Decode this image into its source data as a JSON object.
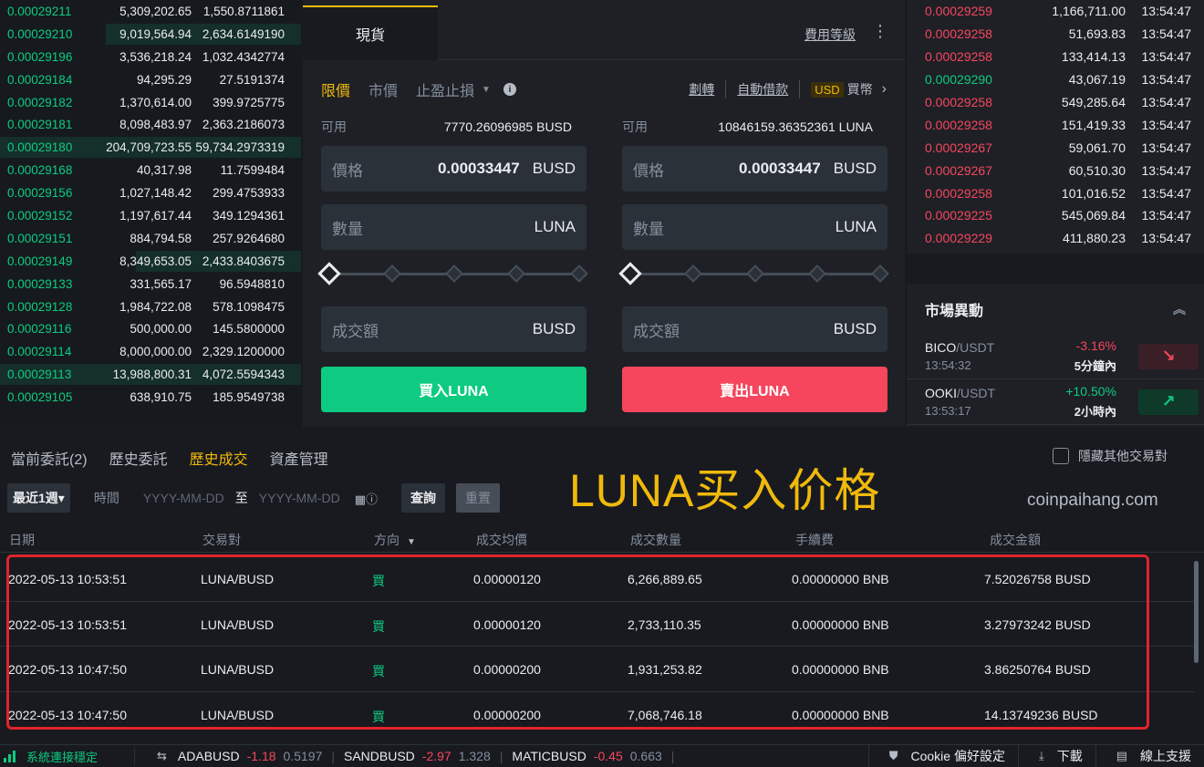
{
  "order_book_bids": [
    {
      "price": "0.00029211",
      "amount": "5,309,202.65",
      "total": "1,550.8711861",
      "depth": 0.0
    },
    {
      "price": "0.00029210",
      "amount": "9,019,564.94",
      "total": "2,634.6149190",
      "depth": 0.65
    },
    {
      "price": "0.00029196",
      "amount": "3,536,218.24",
      "total": "1,032.4342774",
      "depth": 0.0
    },
    {
      "price": "0.00029184",
      "amount": "94,295.29",
      "total": "27.5191374",
      "depth": 0.0
    },
    {
      "price": "0.00029182",
      "amount": "1,370,614.00",
      "total": "399.9725775",
      "depth": 0.0
    },
    {
      "price": "0.00029181",
      "amount": "8,098,483.97",
      "total": "2,363.2186073",
      "depth": 0.0
    },
    {
      "price": "0.00029180",
      "amount": "204,709,723.55",
      "total": "59,734.2973319",
      "depth": 1.0
    },
    {
      "price": "0.00029168",
      "amount": "40,317.98",
      "total": "11.7599484",
      "depth": 0.0
    },
    {
      "price": "0.00029156",
      "amount": "1,027,148.42",
      "total": "299.4753933",
      "depth": 0.0
    },
    {
      "price": "0.00029152",
      "amount": "1,197,617.44",
      "total": "349.1294361",
      "depth": 0.0
    },
    {
      "price": "0.00029151",
      "amount": "884,794.58",
      "total": "257.9264680",
      "depth": 0.0
    },
    {
      "price": "0.00029149",
      "amount": "8,349,653.05",
      "total": "2,433.8403675",
      "depth": 0.55
    },
    {
      "price": "0.00029133",
      "amount": "331,565.17",
      "total": "96.5948810",
      "depth": 0.0
    },
    {
      "price": "0.00029128",
      "amount": "1,984,722.08",
      "total": "578.1098475",
      "depth": 0.0
    },
    {
      "price": "0.00029116",
      "amount": "500,000.00",
      "total": "145.5800000",
      "depth": 0.0
    },
    {
      "price": "0.00029114",
      "amount": "8,000,000.00",
      "total": "2,329.1200000",
      "depth": 0.0
    },
    {
      "price": "0.00029113",
      "amount": "13,988,800.31",
      "total": "4,072.5594343",
      "depth": 1.0
    },
    {
      "price": "0.00029105",
      "amount": "638,910.75",
      "total": "185.9549738",
      "depth": 0.0
    }
  ],
  "center": {
    "tab_spot": "現貨",
    "fee_level": "費用等級",
    "kebab": "⋮",
    "order_types": {
      "limit": "限價",
      "market": "市價",
      "stop": "止盈止損"
    },
    "transfer": "劃轉",
    "auto_borrow": "自動借款",
    "usd_badge": "USD",
    "buy_coin": "買幣",
    "buy": {
      "avail_label": "可用",
      "avail_value": "7770.26096985 BUSD",
      "price_label": "價格",
      "price_value": "0.00033447",
      "price_unit": "BUSD",
      "qty_label": "數量",
      "qty_unit": "LUNA",
      "total_label": "成交額",
      "total_unit": "BUSD",
      "button": "買入LUNA"
    },
    "sell": {
      "avail_label": "可用",
      "avail_value": "10846159.36352361 LUNA",
      "price_label": "價格",
      "price_value": "0.00033447",
      "price_unit": "BUSD",
      "qty_label": "數量",
      "qty_unit": "LUNA",
      "total_label": "成交額",
      "total_unit": "BUSD",
      "button": "賣出LUNA"
    }
  },
  "recent_trades": [
    {
      "price": "0.00029259",
      "amount": "1,166,711.00",
      "time": "13:54:47",
      "side": "red"
    },
    {
      "price": "0.00029258",
      "amount": "51,693.83",
      "time": "13:54:47",
      "side": "red"
    },
    {
      "price": "0.00029258",
      "amount": "133,414.13",
      "time": "13:54:47",
      "side": "red"
    },
    {
      "price": "0.00029290",
      "amount": "43,067.19",
      "time": "13:54:47",
      "side": "green"
    },
    {
      "price": "0.00029258",
      "amount": "549,285.64",
      "time": "13:54:47",
      "side": "red"
    },
    {
      "price": "0.00029258",
      "amount": "151,419.33",
      "time": "13:54:47",
      "side": "red"
    },
    {
      "price": "0.00029267",
      "amount": "59,061.70",
      "time": "13:54:47",
      "side": "red"
    },
    {
      "price": "0.00029267",
      "amount": "60,510.30",
      "time": "13:54:47",
      "side": "red"
    },
    {
      "price": "0.00029258",
      "amount": "101,016.52",
      "time": "13:54:47",
      "side": "red"
    },
    {
      "price": "0.00029225",
      "amount": "545,069.84",
      "time": "13:54:47",
      "side": "red"
    },
    {
      "price": "0.00029229",
      "amount": "411,880.23",
      "time": "13:54:47",
      "side": "red"
    }
  ],
  "market_movers": {
    "title": "市場異動",
    "items": [
      {
        "base": "BICO",
        "quote": "/USDT",
        "time": "13:54:32",
        "change": "-3.16%",
        "period": "5分鐘內",
        "dir": "down",
        "icon": "arrow-down-right-icon"
      },
      {
        "base": "OOKI",
        "quote": "/USDT",
        "time": "13:53:17",
        "change": "+10.50%",
        "period": "2小時內",
        "dir": "up",
        "icon": "arrow-up-right-icon"
      }
    ]
  },
  "bottom": {
    "tabs": [
      "當前委託(2)",
      "歷史委託",
      "歷史成交",
      "資產管理"
    ],
    "active_tab": 2,
    "hide_others": "隱藏其他交易對",
    "range": "最近1週",
    "time_label": "時間",
    "date_placeholder_from": "YYYY-MM-DD",
    "to": "至",
    "date_placeholder_to": "YYYY-MM-DD",
    "query": "查詢",
    "reset": "重置",
    "overlay_title": "LUNA买入价格",
    "watermark": "coinpaihang.com",
    "columns": {
      "date": "日期",
      "pair": "交易對",
      "direction": "方向",
      "avg_price": "成交均價",
      "qty": "成交數量",
      "fee": "手續費",
      "amount": "成交金額"
    },
    "rows": [
      {
        "date": "2022-05-13 10:53:51",
        "pair": "LUNA/BUSD",
        "direction": "買",
        "avg_price": "0.00000120",
        "qty": "6,266,889.65",
        "fee": "0.00000000 BNB",
        "amount": "7.52026758 BUSD"
      },
      {
        "date": "2022-05-13 10:53:51",
        "pair": "LUNA/BUSD",
        "direction": "買",
        "avg_price": "0.00000120",
        "qty": "2,733,110.35",
        "fee": "0.00000000 BNB",
        "amount": "3.27973242 BUSD"
      },
      {
        "date": "2022-05-13 10:47:50",
        "pair": "LUNA/BUSD",
        "direction": "買",
        "avg_price": "0.00000200",
        "qty": "1,931,253.82",
        "fee": "0.00000000 BNB",
        "amount": "3.86250764 BUSD"
      },
      {
        "date": "2022-05-13 10:47:50",
        "pair": "LUNA/BUSD",
        "direction": "買",
        "avg_price": "0.00000200",
        "qty": "7,068,746.18",
        "fee": "0.00000000 BNB",
        "amount": "14.13749236 BUSD"
      }
    ]
  },
  "statusbar": {
    "connection": "系統連接穩定",
    "tickers": [
      {
        "sym": "ADABUSD",
        "chg": "-1.18",
        "px": "0.5197"
      },
      {
        "sym": "SANDBUSD",
        "chg": "-2.97",
        "px": "1.328"
      },
      {
        "sym": "MATICBUSD",
        "chg": "-0.45",
        "px": "0.663"
      }
    ],
    "cookie": "Cookie 偏好設定",
    "download": "下載",
    "support": "線上支援"
  },
  "colors": {
    "accent": "#f0b90b",
    "green": "#0ecb81",
    "red": "#f6465d",
    "highlight": "#e0242c"
  }
}
